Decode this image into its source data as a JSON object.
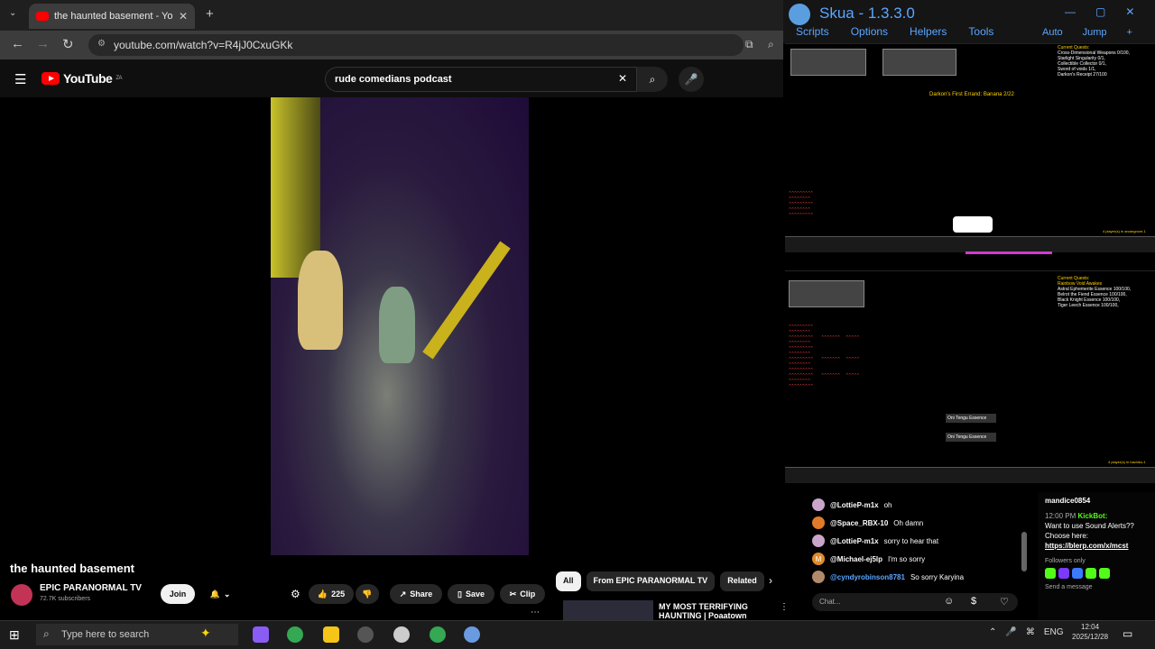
{
  "browser": {
    "tab_title": "the haunted basement - Yo",
    "new_tab": "+",
    "url": "youtube.com/watch?v=R4jJ0CxuGKk"
  },
  "youtube": {
    "logo": "YouTube",
    "logo_sup": "ZA",
    "search_value": "rude comedians podcast",
    "video_title": "the haunted basement",
    "channel_name": "EPIC PARANORMAL TV",
    "subscribers": "72.7K subscribers",
    "join_label": "Join",
    "like_count": "225",
    "share_label": "Share",
    "save_label": "Save",
    "clip_label": "Clip",
    "chips": [
      "All",
      "From EPIC PARANORMAL TV",
      "Related"
    ],
    "rec_title": "MY MOST TERRIFYING HAUNTING | Poaatown School"
  },
  "skua": {
    "title": "Skua - 1.3.3.0",
    "menu": [
      "Scripts",
      "Options",
      "Helpers",
      "Tools"
    ],
    "menu_right": [
      "Auto",
      "Jump"
    ],
    "game1": {
      "quest_title": "Current Quests:",
      "quests": [
        "Cross-Dimensional Weapons 0/100,",
        "Starlight Singularity 0/1,",
        "Collectible Collector 0/1,",
        "Sword of voids 1/1,",
        "Darkon's Receipt 27/100"
      ],
      "center_text": "Darkon's First Errand: Banana 2/22",
      "players": "4 player(s) in arcangrove-1"
    },
    "game2": {
      "quest_title": "Current Quests:",
      "quests": [
        "Rainbow Void Awakes",
        "Astral Ephemerite Essence 100/100,",
        "Belrot the Fiend Essence 100/100,",
        "Black Knight Essence 100/100,",
        "Tiger Leech Essence 100/100,"
      ],
      "loot": [
        "Oni Tengu Essence",
        "Oni Tengu Essence"
      ],
      "players": "4 player(s) in hachiko-1"
    }
  },
  "chat": {
    "messages": [
      {
        "user": "@LottieP-m1x",
        "text": "oh",
        "color": "#c9a6c9"
      },
      {
        "user": "@Space_RBX-10",
        "text": "Oh damn",
        "color": "#e07a2a"
      },
      {
        "user": "@LottieP-m1x",
        "text": "sorry to hear that",
        "color": "#c9a6c9"
      },
      {
        "user": "@Michael-ej5lp",
        "text": "I'm so sorry",
        "color": "#e08a2a"
      },
      {
        "user": "@cyndyrobinson8781",
        "text": "So sorry Karyina",
        "color": "#b08a6a"
      }
    ],
    "input_placeholder": "Chat..."
  },
  "kick": {
    "top_user": "mandice0854",
    "time": "12:00 PM",
    "bot": "KickBot:",
    "text": "Want to use Sound Alerts?? Choose here:",
    "link": "https://blerp.com/x/mcst",
    "followers": "Followers only",
    "send": "Send a message"
  },
  "taskbar": {
    "search_placeholder": "Type here to search",
    "lang": "ENG",
    "time": "12:04",
    "date": "2025/12/28"
  }
}
